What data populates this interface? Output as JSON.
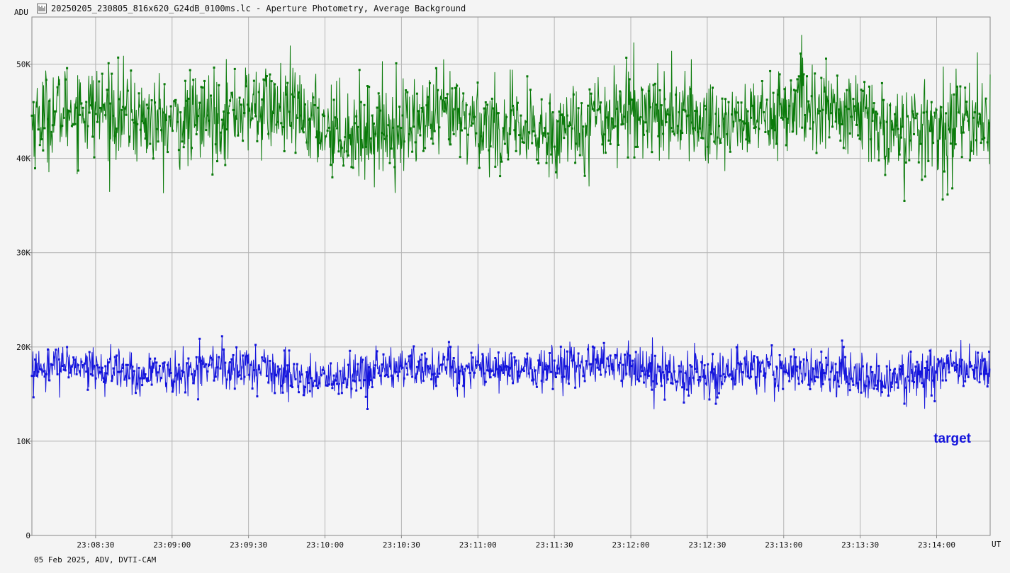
{
  "window": {
    "title": "20250205_230805_816x620_G24dB_0100ms.lc - Aperture Photometry, Average Background",
    "icon": "light-curve-icon"
  },
  "axes": {
    "y_unit": "ADU",
    "x_unit": "UT"
  },
  "footer": {
    "info": "05 Feb 2025, ADV, DVTI-CAM"
  },
  "chart_data": {
    "type": "line",
    "title": "20250205_230805_816x620_G24dB_0100ms.lc - Aperture Photometry, Average Background",
    "xlabel": "UT",
    "ylabel": "ADU",
    "x_range": [
      "23:08:05",
      "23:14:21"
    ],
    "ylim": [
      0,
      55000
    ],
    "yticks": [
      0,
      10000,
      20000,
      30000,
      40000,
      50000
    ],
    "ytick_labels": [
      "0",
      "10K",
      "20K",
      "30K",
      "40K",
      "50K"
    ],
    "xticks": [
      "23:08:30",
      "23:09:00",
      "23:09:30",
      "23:10:00",
      "23:10:30",
      "23:11:00",
      "23:11:30",
      "23:12:00",
      "23:12:30",
      "23:13:00",
      "23:13:30",
      "23:14:00"
    ],
    "grid": true,
    "series": [
      {
        "color": "#0a7a0a",
        "mean": 44000,
        "std": 2700,
        "min": 35500,
        "max": 53200
      },
      {
        "name": "target",
        "color": "#1414dc",
        "mean": 17500,
        "std": 1300,
        "min": 13400,
        "max": 23100
      }
    ],
    "legend": "bottom-right"
  },
  "colors": {
    "background": "#f4f4f4",
    "grid": "#b4b4b4",
    "axis": "#888888"
  }
}
